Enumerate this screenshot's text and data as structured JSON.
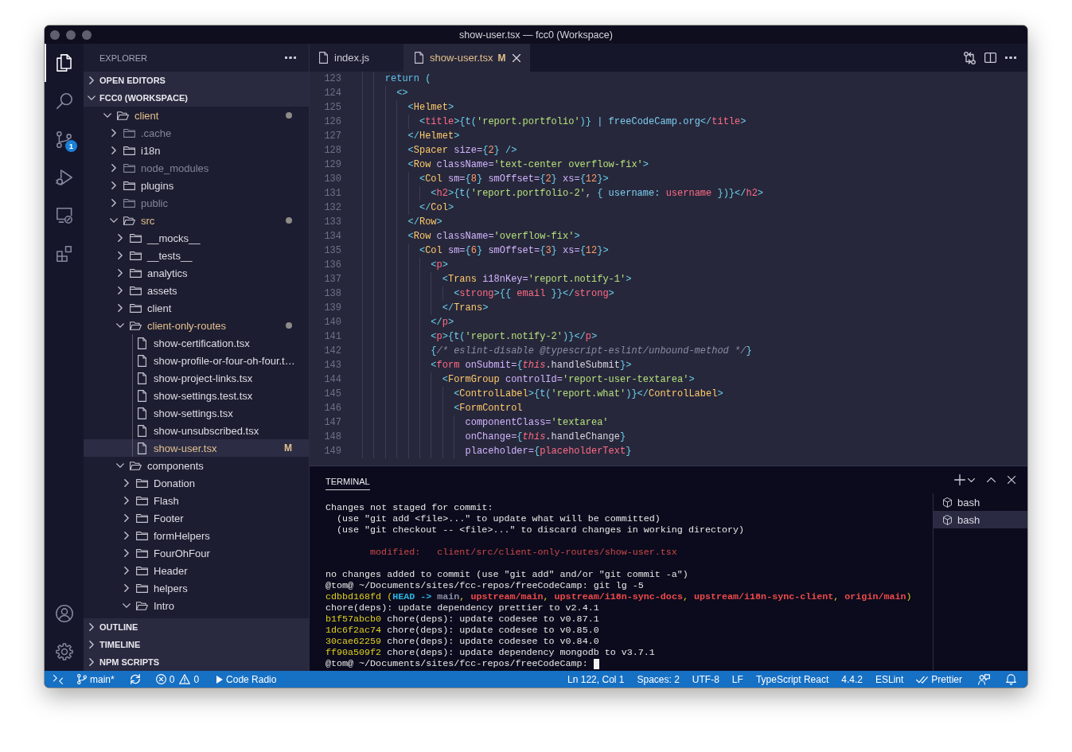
{
  "window": {
    "title": "show-user.tsx — fcc0 (Workspace)"
  },
  "activity_bar": {
    "items": [
      {
        "kind": "explorer",
        "selected": true
      },
      {
        "kind": "search",
        "selected": false
      },
      {
        "kind": "source-control",
        "selected": false,
        "badge": "1"
      },
      {
        "kind": "run-debug",
        "selected": false
      },
      {
        "kind": "remote",
        "selected": false
      },
      {
        "kind": "extensions",
        "selected": false
      }
    ],
    "bottom_items": [
      {
        "kind": "account"
      },
      {
        "kind": "settings"
      }
    ]
  },
  "sidebar": {
    "title": "EXPLORER",
    "sections": [
      {
        "title": "OPEN EDITORS",
        "expanded": false
      },
      {
        "title": "FCC0 (WORKSPACE)",
        "expanded": true,
        "tree": [
          {
            "label": "client",
            "kind": "folder",
            "expanded": true,
            "modified": true,
            "dimmed": false,
            "selected": false,
            "children": [
              {
                "label": ".cache",
                "kind": "folder",
                "expanded": false,
                "modified": false,
                "dimmed": true,
                "selected": false
              },
              {
                "label": "i18n",
                "kind": "folder",
                "expanded": false,
                "modified": false,
                "dimmed": false,
                "selected": false
              },
              {
                "label": "node_modules",
                "kind": "folder",
                "expanded": false,
                "modified": false,
                "dimmed": true,
                "selected": false
              },
              {
                "label": "plugins",
                "kind": "folder",
                "expanded": false,
                "modified": false,
                "dimmed": false,
                "selected": false
              },
              {
                "label": "public",
                "kind": "folder",
                "expanded": false,
                "modified": false,
                "dimmed": true,
                "selected": false
              },
              {
                "label": "src",
                "kind": "folder",
                "expanded": true,
                "modified": true,
                "dimmed": false,
                "selected": false,
                "children": [
                  {
                    "label": "__mocks__",
                    "kind": "folder",
                    "expanded": false,
                    "modified": false,
                    "dimmed": false,
                    "selected": false
                  },
                  {
                    "label": "__tests__",
                    "kind": "folder",
                    "expanded": false,
                    "modified": false,
                    "dimmed": false,
                    "selected": false
                  },
                  {
                    "label": "analytics",
                    "kind": "folder",
                    "expanded": false,
                    "modified": false,
                    "dimmed": false,
                    "selected": false
                  },
                  {
                    "label": "assets",
                    "kind": "folder",
                    "expanded": false,
                    "modified": false,
                    "dimmed": false,
                    "selected": false
                  },
                  {
                    "label": "client",
                    "kind": "folder",
                    "expanded": false,
                    "modified": false,
                    "dimmed": false,
                    "selected": false
                  },
                  {
                    "label": "client-only-routes",
                    "kind": "folder",
                    "expanded": true,
                    "modified": true,
                    "dimmed": false,
                    "selected": false,
                    "children": [
                      {
                        "label": "show-certification.tsx",
                        "kind": "file",
                        "modified": false,
                        "dimmed": false,
                        "selected": false
                      },
                      {
                        "label": "show-profile-or-four-oh-four.t…",
                        "kind": "file",
                        "modified": false,
                        "dimmed": false,
                        "selected": false
                      },
                      {
                        "label": "show-project-links.tsx",
                        "kind": "file",
                        "modified": false,
                        "dimmed": false,
                        "selected": false
                      },
                      {
                        "label": "show-settings.test.tsx",
                        "kind": "file",
                        "modified": false,
                        "dimmed": false,
                        "selected": false
                      },
                      {
                        "label": "show-settings.tsx",
                        "kind": "file",
                        "modified": false,
                        "dimmed": false,
                        "selected": false
                      },
                      {
                        "label": "show-unsubscribed.tsx",
                        "kind": "file",
                        "modified": false,
                        "dimmed": false,
                        "selected": false
                      },
                      {
                        "label": "show-user.tsx",
                        "kind": "file",
                        "modified": true,
                        "dimmed": false,
                        "selected": true,
                        "badge": "M"
                      }
                    ]
                  },
                  {
                    "label": "components",
                    "kind": "folder",
                    "expanded": true,
                    "modified": false,
                    "dimmed": false,
                    "selected": false,
                    "children": [
                      {
                        "label": "Donation",
                        "kind": "folder",
                        "expanded": false,
                        "modified": false,
                        "dimmed": false,
                        "selected": false
                      },
                      {
                        "label": "Flash",
                        "kind": "folder",
                        "expanded": false,
                        "modified": false,
                        "dimmed": false,
                        "selected": false
                      },
                      {
                        "label": "Footer",
                        "kind": "folder",
                        "expanded": false,
                        "modified": false,
                        "dimmed": false,
                        "selected": false
                      },
                      {
                        "label": "formHelpers",
                        "kind": "folder",
                        "expanded": false,
                        "modified": false,
                        "dimmed": false,
                        "selected": false
                      },
                      {
                        "label": "FourOhFour",
                        "kind": "folder",
                        "expanded": false,
                        "modified": false,
                        "dimmed": false,
                        "selected": false
                      },
                      {
                        "label": "Header",
                        "kind": "folder",
                        "expanded": false,
                        "modified": false,
                        "dimmed": false,
                        "selected": false
                      },
                      {
                        "label": "helpers",
                        "kind": "folder",
                        "expanded": false,
                        "modified": false,
                        "dimmed": false,
                        "selected": false
                      },
                      {
                        "label": "Intro",
                        "kind": "folder",
                        "expanded": true,
                        "modified": false,
                        "dimmed": false,
                        "selected": false
                      }
                    ]
                  }
                ]
              }
            ]
          }
        ]
      },
      {
        "title": "OUTLINE",
        "expanded": false
      },
      {
        "title": "TIMELINE",
        "expanded": false
      },
      {
        "title": "NPM SCRIPTS",
        "expanded": false
      }
    ]
  },
  "editor": {
    "tabs": [
      {
        "label": "index.js",
        "selected": false,
        "modified": false
      },
      {
        "label": "show-user.tsx",
        "selected": true,
        "modified": true,
        "badge": "M"
      }
    ],
    "lines": [
      {
        "number": "123",
        "tokens": [
          {
            "text": "    return",
            "kind": "kw"
          },
          {
            "text": " (",
            "kind": "p"
          }
        ]
      },
      {
        "number": "124",
        "tokens": [
          {
            "text": "      <>",
            "kind": "p"
          }
        ]
      },
      {
        "number": "125",
        "tokens": [
          {
            "text": "        <",
            "kind": "p"
          },
          {
            "text": "Helmet",
            "kind": "comp"
          },
          {
            "text": ">",
            "kind": "p"
          }
        ]
      },
      {
        "number": "126",
        "tokens": [
          {
            "text": "          <",
            "kind": "p"
          },
          {
            "text": "title",
            "kind": "tag"
          },
          {
            "text": ">{",
            "kind": "p"
          },
          {
            "text": "t",
            "kind": "fn"
          },
          {
            "text": "(",
            "kind": "p"
          },
          {
            "text": "'report.portfolio'",
            "kind": "str"
          },
          {
            "text": ")}",
            "kind": "p"
          },
          {
            "text": " | freeCodeCamp.org",
            "kind": "jsx"
          },
          {
            "text": "</",
            "kind": "p"
          },
          {
            "text": "title",
            "kind": "tag"
          },
          {
            "text": ">",
            "kind": "p"
          }
        ]
      },
      {
        "number": "127",
        "tokens": [
          {
            "text": "        </",
            "kind": "p"
          },
          {
            "text": "Helmet",
            "kind": "comp"
          },
          {
            "text": ">",
            "kind": "p"
          }
        ]
      },
      {
        "number": "128",
        "tokens": [
          {
            "text": "        <",
            "kind": "p"
          },
          {
            "text": "Spacer",
            "kind": "comp"
          },
          {
            "text": " size=",
            "kind": "attr"
          },
          {
            "text": "{",
            "kind": "p"
          },
          {
            "text": "2",
            "kind": "num"
          },
          {
            "text": "} />",
            "kind": "p"
          }
        ]
      },
      {
        "number": "129",
        "tokens": [
          {
            "text": "        <",
            "kind": "p"
          },
          {
            "text": "Row",
            "kind": "comp"
          },
          {
            "text": " className=",
            "kind": "attr"
          },
          {
            "text": "'text-center overflow-fix'",
            "kind": "str"
          },
          {
            "text": ">",
            "kind": "p"
          }
        ]
      },
      {
        "number": "130",
        "tokens": [
          {
            "text": "          <",
            "kind": "p"
          },
          {
            "text": "Col",
            "kind": "comp"
          },
          {
            "text": " sm=",
            "kind": "attr"
          },
          {
            "text": "{",
            "kind": "p"
          },
          {
            "text": "8",
            "kind": "num"
          },
          {
            "text": "}",
            "kind": "p"
          },
          {
            "text": " smOffset=",
            "kind": "attr"
          },
          {
            "text": "{",
            "kind": "p"
          },
          {
            "text": "2",
            "kind": "num"
          },
          {
            "text": "}",
            "kind": "p"
          },
          {
            "text": " xs=",
            "kind": "attr"
          },
          {
            "text": "{",
            "kind": "p"
          },
          {
            "text": "12",
            "kind": "num"
          },
          {
            "text": "}>",
            "kind": "p"
          }
        ]
      },
      {
        "number": "131",
        "tokens": [
          {
            "text": "            <",
            "kind": "p"
          },
          {
            "text": "h2",
            "kind": "tag"
          },
          {
            "text": ">{",
            "kind": "p"
          },
          {
            "text": "t",
            "kind": "fn"
          },
          {
            "text": "(",
            "kind": "p"
          },
          {
            "text": "'report.portfolio-2'",
            "kind": "str"
          },
          {
            "text": ", ",
            "kind": "plain"
          },
          {
            "text": "{ ",
            "kind": "p"
          },
          {
            "text": "username: ",
            "kind": "prop"
          },
          {
            "text": "username",
            "kind": "var"
          },
          {
            "text": " })}</",
            "kind": "p"
          },
          {
            "text": "h2",
            "kind": "tag"
          },
          {
            "text": ">",
            "kind": "p"
          }
        ]
      },
      {
        "number": "132",
        "tokens": [
          {
            "text": "          </",
            "kind": "p"
          },
          {
            "text": "Col",
            "kind": "comp"
          },
          {
            "text": ">",
            "kind": "p"
          }
        ]
      },
      {
        "number": "133",
        "tokens": [
          {
            "text": "        </",
            "kind": "p"
          },
          {
            "text": "Row",
            "kind": "comp"
          },
          {
            "text": ">",
            "kind": "p"
          }
        ]
      },
      {
        "number": "134",
        "tokens": [
          {
            "text": "        <",
            "kind": "p"
          },
          {
            "text": "Row",
            "kind": "comp"
          },
          {
            "text": " className=",
            "kind": "attr"
          },
          {
            "text": "'overflow-fix'",
            "kind": "str"
          },
          {
            "text": ">",
            "kind": "p"
          }
        ]
      },
      {
        "number": "135",
        "tokens": [
          {
            "text": "          <",
            "kind": "p"
          },
          {
            "text": "Col",
            "kind": "comp"
          },
          {
            "text": " sm=",
            "kind": "attr"
          },
          {
            "text": "{",
            "kind": "p"
          },
          {
            "text": "6",
            "kind": "num"
          },
          {
            "text": "}",
            "kind": "p"
          },
          {
            "text": " smOffset=",
            "kind": "attr"
          },
          {
            "text": "{",
            "kind": "p"
          },
          {
            "text": "3",
            "kind": "num"
          },
          {
            "text": "}",
            "kind": "p"
          },
          {
            "text": " xs=",
            "kind": "attr"
          },
          {
            "text": "{",
            "kind": "p"
          },
          {
            "text": "12",
            "kind": "num"
          },
          {
            "text": "}>",
            "kind": "p"
          }
        ]
      },
      {
        "number": "136",
        "tokens": [
          {
            "text": "            <",
            "kind": "p"
          },
          {
            "text": "p",
            "kind": "tag"
          },
          {
            "text": ">",
            "kind": "p"
          }
        ]
      },
      {
        "number": "137",
        "tokens": [
          {
            "text": "              <",
            "kind": "p"
          },
          {
            "text": "Trans",
            "kind": "comp"
          },
          {
            "text": " i18nKey=",
            "kind": "attr"
          },
          {
            "text": "'report.notify-1'",
            "kind": "str"
          },
          {
            "text": ">",
            "kind": "p"
          }
        ]
      },
      {
        "number": "138",
        "tokens": [
          {
            "text": "                <",
            "kind": "p"
          },
          {
            "text": "strong",
            "kind": "tag"
          },
          {
            "text": ">{{ ",
            "kind": "p"
          },
          {
            "text": "email",
            "kind": "var"
          },
          {
            "text": " }}</",
            "kind": "p"
          },
          {
            "text": "strong",
            "kind": "tag"
          },
          {
            "text": ">",
            "kind": "p"
          }
        ]
      },
      {
        "number": "139",
        "tokens": [
          {
            "text": "              </",
            "kind": "p"
          },
          {
            "text": "Trans",
            "kind": "comp"
          },
          {
            "text": ">",
            "kind": "p"
          }
        ]
      },
      {
        "number": "140",
        "tokens": [
          {
            "text": "            </",
            "kind": "p"
          },
          {
            "text": "p",
            "kind": "tag"
          },
          {
            "text": ">",
            "kind": "p"
          }
        ]
      },
      {
        "number": "141",
        "tokens": [
          {
            "text": "            <",
            "kind": "p"
          },
          {
            "text": "p",
            "kind": "tag"
          },
          {
            "text": ">{",
            "kind": "p"
          },
          {
            "text": "t",
            "kind": "fn"
          },
          {
            "text": "(",
            "kind": "p"
          },
          {
            "text": "'report.notify-2'",
            "kind": "str"
          },
          {
            "text": ")}</",
            "kind": "p"
          },
          {
            "text": "p",
            "kind": "tag"
          },
          {
            "text": ">",
            "kind": "p"
          }
        ]
      },
      {
        "number": "142",
        "tokens": [
          {
            "text": "            {",
            "kind": "p"
          },
          {
            "text": "/* eslint-disable @typescript-eslint/unbound-method */",
            "kind": "cmt"
          },
          {
            "text": "}",
            "kind": "p"
          }
        ]
      },
      {
        "number": "143",
        "tokens": [
          {
            "text": "            <",
            "kind": "p"
          },
          {
            "text": "form",
            "kind": "tag"
          },
          {
            "text": " onSubmit=",
            "kind": "attr"
          },
          {
            "text": "{",
            "kind": "p"
          },
          {
            "text": "this",
            "kind": "this"
          },
          {
            "text": ".handleSubmit",
            "kind": "mem"
          },
          {
            "text": "}>",
            "kind": "p"
          }
        ]
      },
      {
        "number": "144",
        "tokens": [
          {
            "text": "              <",
            "kind": "p"
          },
          {
            "text": "FormGroup",
            "kind": "comp"
          },
          {
            "text": " controlId=",
            "kind": "attr"
          },
          {
            "text": "'report-user-textarea'",
            "kind": "str"
          },
          {
            "text": ">",
            "kind": "p"
          }
        ]
      },
      {
        "number": "145",
        "tokens": [
          {
            "text": "                <",
            "kind": "p"
          },
          {
            "text": "ControlLabel",
            "kind": "comp"
          },
          {
            "text": ">{",
            "kind": "p"
          },
          {
            "text": "t",
            "kind": "fn"
          },
          {
            "text": "(",
            "kind": "p"
          },
          {
            "text": "'report.what'",
            "kind": "str"
          },
          {
            "text": ")}</",
            "kind": "p"
          },
          {
            "text": "ControlLabel",
            "kind": "comp"
          },
          {
            "text": ">",
            "kind": "p"
          }
        ]
      },
      {
        "number": "146",
        "tokens": [
          {
            "text": "                <",
            "kind": "p"
          },
          {
            "text": "FormControl",
            "kind": "comp"
          }
        ]
      },
      {
        "number": "147",
        "tokens": [
          {
            "text": "                  componentClass=",
            "kind": "attr"
          },
          {
            "text": "'textarea'",
            "kind": "str"
          }
        ]
      },
      {
        "number": "148",
        "tokens": [
          {
            "text": "                  onChange=",
            "kind": "attr"
          },
          {
            "text": "{",
            "kind": "p"
          },
          {
            "text": "this",
            "kind": "this"
          },
          {
            "text": ".handleChange",
            "kind": "mem"
          },
          {
            "text": "}",
            "kind": "p"
          }
        ]
      },
      {
        "number": "149",
        "tokens": [
          {
            "text": "                  placeholder=",
            "kind": "attr"
          },
          {
            "text": "{",
            "kind": "p"
          },
          {
            "text": "placeholderText",
            "kind": "var"
          },
          {
            "text": "}",
            "kind": "p"
          }
        ]
      }
    ]
  },
  "panel": {
    "tabs": [
      {
        "label": "TERMINAL",
        "selected": true
      }
    ],
    "terminal": {
      "cursor": true,
      "lines": [
        {
          "kind": "output",
          "segments": [
            {
              "text": "Changes not staged for commit:",
              "kind": "plain"
            }
          ]
        },
        {
          "kind": "output",
          "segments": [
            {
              "text": "  (use \"git add <file>...\" to update what will be committed)",
              "kind": "plain"
            }
          ]
        },
        {
          "kind": "output",
          "segments": [
            {
              "text": "  (use \"git checkout -- <file>...\" to discard changes in working directory)",
              "kind": "plain"
            }
          ]
        },
        {
          "kind": "blank"
        },
        {
          "kind": "output",
          "segments": [
            {
              "text": "        modified:   client/src/client-only-routes/show-user.tsx",
              "kind": "red"
            }
          ]
        },
        {
          "kind": "blank"
        },
        {
          "kind": "output",
          "segments": [
            {
              "text": "no changes added to commit (use \"git add\" and/or \"git commit -a\")",
              "kind": "plain"
            }
          ]
        },
        {
          "kind": "output",
          "segments": [
            {
              "text": "@tom@ ~/Documents/sites/fcc-repos/freeCodeCamp: git lg -5",
              "kind": "plain"
            }
          ]
        },
        {
          "kind": "output",
          "segments": [
            {
              "text": "cdbbd168fd (",
              "kind": "hash"
            },
            {
              "text": "HEAD -> ",
              "kind": "head"
            },
            {
              "text": "main",
              "kind": "local"
            },
            {
              "text": ", ",
              "kind": "hash"
            },
            {
              "text": "upstream/main",
              "kind": "remote"
            },
            {
              "text": ", ",
              "kind": "hash"
            },
            {
              "text": "upstream/i18n-sync-docs",
              "kind": "remote"
            },
            {
              "text": ", ",
              "kind": "hash"
            },
            {
              "text": "upstream/i18n-sync-client",
              "kind": "remote"
            },
            {
              "text": ", ",
              "kind": "hash"
            },
            {
              "text": "origin/main",
              "kind": "remote"
            },
            {
              "text": ")",
              "kind": "hash"
            }
          ]
        },
        {
          "kind": "output",
          "segments": [
            {
              "text": "chore(deps): update dependency prettier to v2.4.1",
              "kind": "plain"
            }
          ]
        },
        {
          "kind": "output",
          "segments": [
            {
              "text": "b1f57abcb0",
              "kind": "hash"
            },
            {
              "text": " chore(deps): update codesee to v0.87.1",
              "kind": "plain"
            }
          ]
        },
        {
          "kind": "output",
          "segments": [
            {
              "text": "1dc6f2ac74",
              "kind": "hash"
            },
            {
              "text": " chore(deps): update codesee to v0.85.0",
              "kind": "plain"
            }
          ]
        },
        {
          "kind": "output",
          "segments": [
            {
              "text": "30cae62259",
              "kind": "hash"
            },
            {
              "text": " chore(deps): update codesee to v0.84.0",
              "kind": "plain"
            }
          ]
        },
        {
          "kind": "output",
          "segments": [
            {
              "text": "ff90a509f2",
              "kind": "hash"
            },
            {
              "text": " chore(deps): update dependency mongodb to v3.7.1",
              "kind": "plain"
            }
          ]
        },
        {
          "kind": "output",
          "segments": [
            {
              "text": "@tom@ ~/Documents/sites/fcc-repos/freeCodeCamp: ",
              "kind": "plain"
            }
          ]
        }
      ]
    },
    "sessions": [
      {
        "label": "bash",
        "selected": false
      },
      {
        "label": "bash",
        "selected": true
      }
    ]
  },
  "status_bar": {
    "left": [
      {
        "kind": "remote"
      },
      {
        "kind": "branch",
        "label": "main*"
      },
      {
        "kind": "sync"
      },
      {
        "kind": "problems",
        "errors": "0",
        "warnings": "0"
      },
      {
        "kind": "play",
        "label": "Code Radio"
      }
    ],
    "right": [
      {
        "kind": "text",
        "label": "Ln 122, Col 1"
      },
      {
        "kind": "text",
        "label": "Spaces: 2"
      },
      {
        "kind": "text",
        "label": "UTF-8"
      },
      {
        "kind": "text",
        "label": "LF"
      },
      {
        "kind": "text",
        "label": "TypeScript React"
      },
      {
        "kind": "text",
        "label": "4.4.2"
      },
      {
        "kind": "text",
        "label": "ESLint"
      },
      {
        "kind": "check",
        "label": "Prettier"
      },
      {
        "kind": "feedback"
      },
      {
        "kind": "bell"
      }
    ]
  }
}
